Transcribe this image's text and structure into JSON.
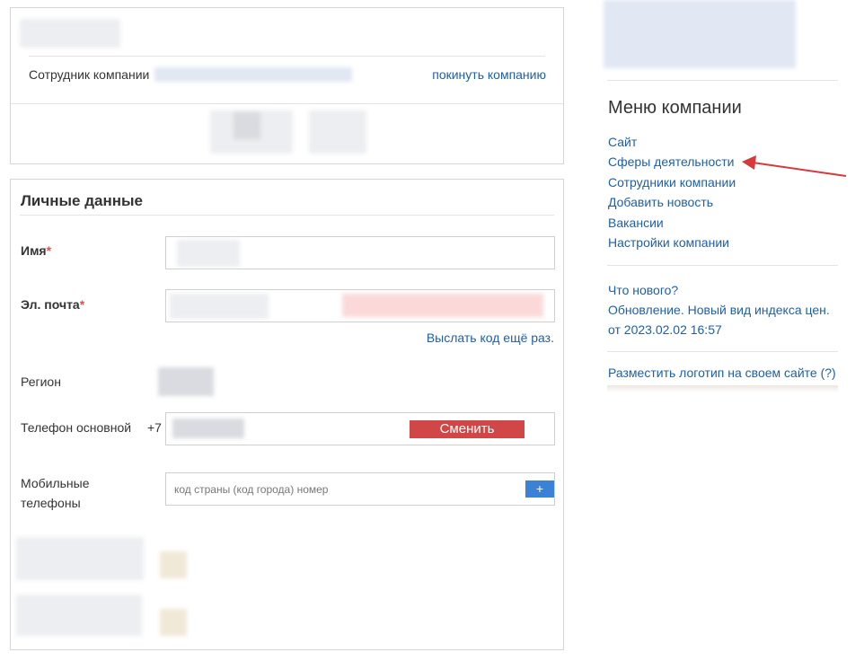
{
  "company_card": {
    "employee_label": "Сотрудник компании",
    "leave_link": "покинуть компанию"
  },
  "personal": {
    "title": "Личные данные",
    "name_label": "Имя",
    "email_label": "Эл. почта",
    "required_mark": "*",
    "resend_link": "Выслать код ещё раз.",
    "region_label": "Регион",
    "phone_label": "Телефон основной",
    "phone_prefix": "+7",
    "change_button": "Сменить",
    "mobile_label_1": "Мобильные",
    "mobile_label_2": "телефоны",
    "mobile_placeholder": "код страны (код города) номер",
    "add_button": "+"
  },
  "sidebar": {
    "menu_title": "Меню компании",
    "menu_items": [
      {
        "label": "Сайт"
      },
      {
        "label": "Сферы деятельности"
      },
      {
        "label": "Сотрудники компании"
      },
      {
        "label": "Добавить новость"
      },
      {
        "label": "Вакансии"
      },
      {
        "label": "Настройки компании"
      }
    ],
    "news_heading": "Что нового?",
    "news_text": "Обновление. Новый вид индекса цен.",
    "news_date": "от 2023.02.02 16:57",
    "logo_link": "Разместить логотип на своем сайте (?)"
  },
  "colors": {
    "link": "#1e5fa8",
    "required": "#d9534f",
    "change_button": "#d14646",
    "add_button": "#3b82d6",
    "annotation_arrow": "#d63a3a"
  },
  "icons": {
    "annotation_arrow": "red-arrow-icon"
  }
}
